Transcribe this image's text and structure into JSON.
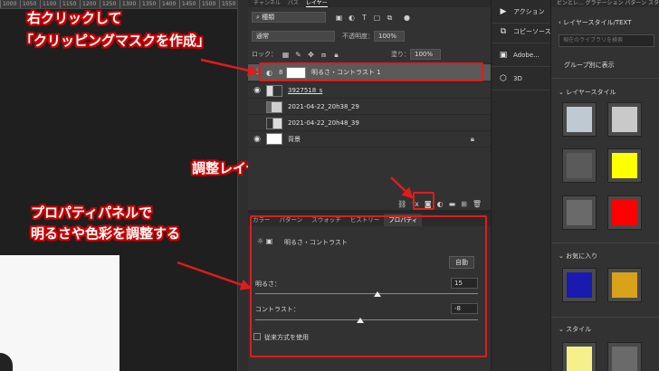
{
  "ruler": {
    "ticks": [
      "1000",
      "1050",
      "1100",
      "1150",
      "1200",
      "1250",
      "1300",
      "1350",
      "1400",
      "1450",
      "1500",
      "1550"
    ]
  },
  "annotations": {
    "clip_line1": "右クリックして",
    "clip_line2": "「クリッピングマスクを作成」",
    "adjust": "調整レイヤーを出す",
    "props_line1": "プロパティパネルで",
    "props_line2": "明るさや色彩を調整する",
    "accent_color": "#e21b1b"
  },
  "layers_panel": {
    "tabs": [
      "チャンネル",
      "パス",
      "レイヤー"
    ],
    "active_tab": "レイヤー",
    "filter_value": "種類",
    "blend_mode": "通常",
    "opacity_label": "不透明度：",
    "opacity_value": "100%",
    "lock_label": "ロック：",
    "fill_label": "塗り：",
    "fill_value": "100%",
    "layers": [
      {
        "name": "明るさ・コントラスト 1",
        "kind": "adjustment",
        "selected": true
      },
      {
        "name": "3927518_s",
        "kind": "image"
      },
      {
        "name": "2021-04-22_20h38_29",
        "kind": "image"
      },
      {
        "name": "2021-04-22_20h48_39",
        "kind": "image"
      },
      {
        "name": "背景",
        "kind": "background"
      }
    ]
  },
  "properties": {
    "tabs": [
      "カラー",
      "パターン",
      "スウォッチ",
      "ヒストリー",
      "プロパティ"
    ],
    "active_tab": "プロパティ",
    "title": "明るさ・コントラスト",
    "auto_button": "自動",
    "brightness_label": "明るさ：",
    "brightness_value": "15",
    "brightness_level": 0.55,
    "contrast_label": "コントラスト：",
    "contrast_value": "-8",
    "contrast_level": 0.47,
    "legacy_label": "従来方式を使用"
  },
  "actions": {
    "items": [
      {
        "label": "アクション",
        "icon": "play-icon"
      },
      {
        "label": "コピーソース",
        "icon": "clone-source-icon"
      },
      {
        "label": "Adobe...",
        "icon": "adobe-icon"
      },
      {
        "label": "3D",
        "icon": "3d-icon"
      }
    ]
  },
  "styles_panel": {
    "tabbar": "ビンとレ... グラデーション  パターン  スタ",
    "title": "レイヤースタイル/TEXT",
    "search_placeholder": "現在のライブラリを検索",
    "group_view": "グループ別に表示",
    "group_layer_style": "レイヤースタイル",
    "group_favorites": "お気に入り",
    "group_style": "スタイル",
    "swatches": [
      "#bfc9d1",
      "#c9c9c9",
      "#5a5a5a",
      "#ffff00",
      "#6a6a6a",
      "#ff0000",
      "#1a1ab0",
      "#d8a21b",
      "#f6f08a",
      "#6a6a6a"
    ]
  }
}
